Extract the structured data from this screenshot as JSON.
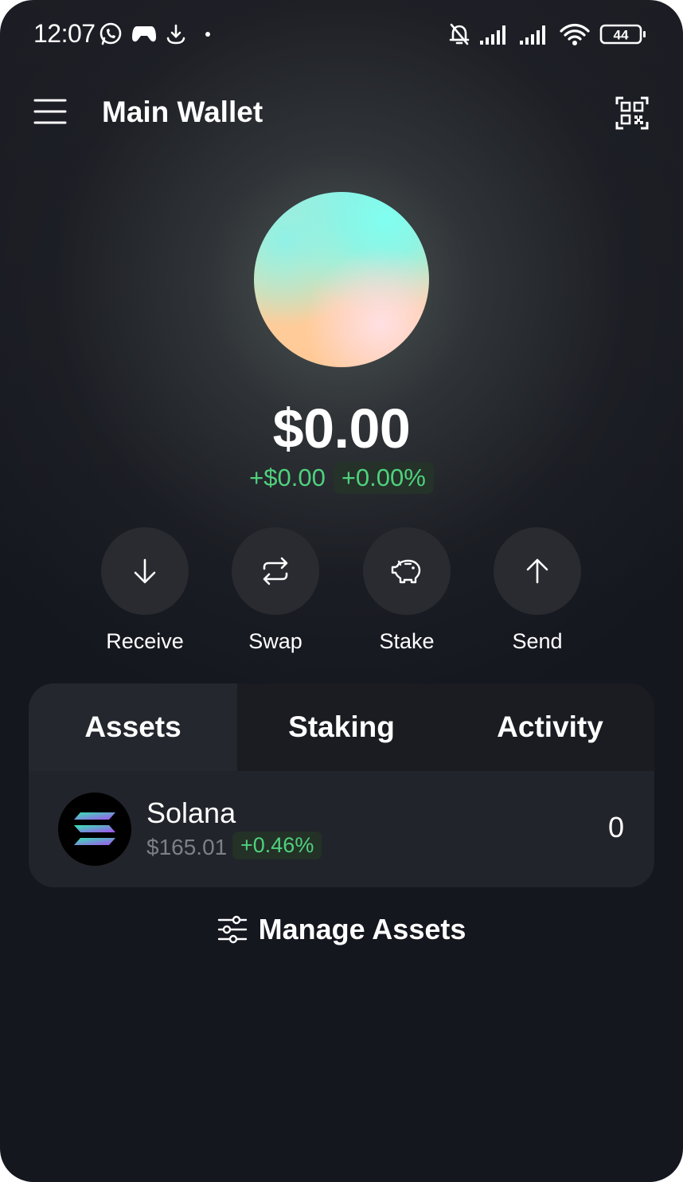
{
  "status_bar": {
    "time": "12:07",
    "battery": "44",
    "icons": [
      "whatsapp-icon",
      "game-controller-icon",
      "anchor-download-icon",
      "dot-icon",
      "muted-bell-icon",
      "signal-icon",
      "signal-icon",
      "wifi-icon",
      "battery-icon"
    ]
  },
  "header": {
    "title": "Main Wallet",
    "menu_icon": "hamburger-menu-icon",
    "qr_icon": "qr-code-icon"
  },
  "balance": {
    "total": "$0.00",
    "change_amount": "+$0.00",
    "change_percent": "+0.00%"
  },
  "actions": [
    {
      "label": "Receive",
      "icon": "arrow-down-icon"
    },
    {
      "label": "Swap",
      "icon": "swap-arrows-icon"
    },
    {
      "label": "Stake",
      "icon": "piggy-bank-icon"
    },
    {
      "label": "Send",
      "icon": "arrow-up-icon"
    }
  ],
  "tabs": [
    {
      "label": "Assets",
      "active": true
    },
    {
      "label": "Staking",
      "active": false
    },
    {
      "label": "Activity",
      "active": false
    }
  ],
  "assets": [
    {
      "name": "Solana",
      "price": "$165.01",
      "change": "+0.46%",
      "balance": "0",
      "icon": "solana-logo-icon"
    }
  ],
  "manage": {
    "label": "Manage Assets",
    "icon": "sliders-icon"
  },
  "colors": {
    "positive": "#4fd17d",
    "background": "#15171f",
    "button_bg": "#292b31",
    "muted_text": "#7d8088"
  }
}
